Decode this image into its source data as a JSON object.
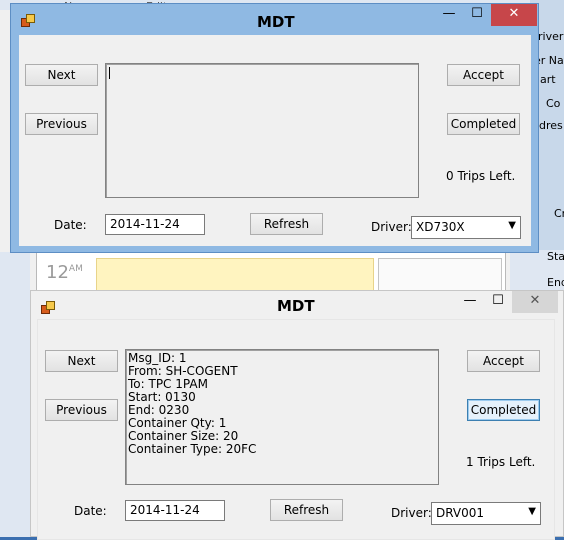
{
  "background": {
    "menu": [
      "New",
      "Edit"
    ],
    "right_labels": [
      "river I",
      "er Na",
      "art",
      "Co",
      "ddres",
      "Cr",
      "Sta",
      "End"
    ],
    "calendar_hour": "12",
    "calendar_ampm": "AM"
  },
  "window_back": {
    "title": "MDT",
    "caption": {
      "minimize": "—",
      "maximize": "☐",
      "close": "✕"
    },
    "next_label": "Next",
    "previous_label": "Previous",
    "accept_label": "Accept",
    "completed_label": "Completed",
    "trips_left": "0 Trips Left.",
    "message_lines": [],
    "date_label": "Date:",
    "date_value": "2014-11-24",
    "refresh_label": "Refresh",
    "driver_label": "Driver:",
    "driver_value": "XD730X"
  },
  "window_front": {
    "title": "MDT",
    "caption": {
      "minimize": "—",
      "maximize": "☐",
      "close": "✕"
    },
    "next_label": "Next",
    "previous_label": "Previous",
    "accept_label": "Accept",
    "completed_label": "Completed",
    "trips_left": "1 Trips Left.",
    "message_lines": [
      "Msg_ID: 1",
      "From: SH-COGENT",
      "To: TPC 1PAM",
      "Start: 0130",
      "End: 0230",
      "Container Qty: 1",
      "Container Size: 20",
      "Container Type: 20FC"
    ],
    "date_label": "Date:",
    "date_value": "2014-11-24",
    "refresh_label": "Refresh",
    "driver_label": "Driver:",
    "driver_value": "DRV001"
  },
  "colors": {
    "desktop": "#3b6fb0",
    "active_titlebar": "#8fb9e3",
    "close_button": "#c7464a",
    "focus_border": "#3c7fb1"
  }
}
